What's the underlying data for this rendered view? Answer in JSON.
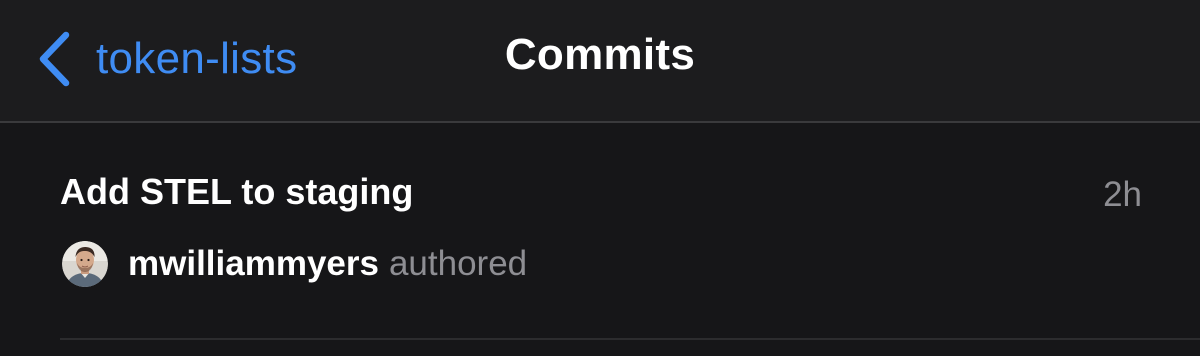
{
  "nav": {
    "back_label": "token-lists",
    "title": "Commits",
    "back_icon": "chevron-left-icon"
  },
  "commit": {
    "message": "Add STEL to staging",
    "time": "2h",
    "author": "mwilliammyers",
    "action": "authored"
  },
  "colors": {
    "background": "#161618",
    "nav_background": "#1c1c1e",
    "accent": "#3f8cf3",
    "primary_text": "#ffffff",
    "secondary_text": "#8e8e93",
    "separator": "#3a3a3c"
  }
}
